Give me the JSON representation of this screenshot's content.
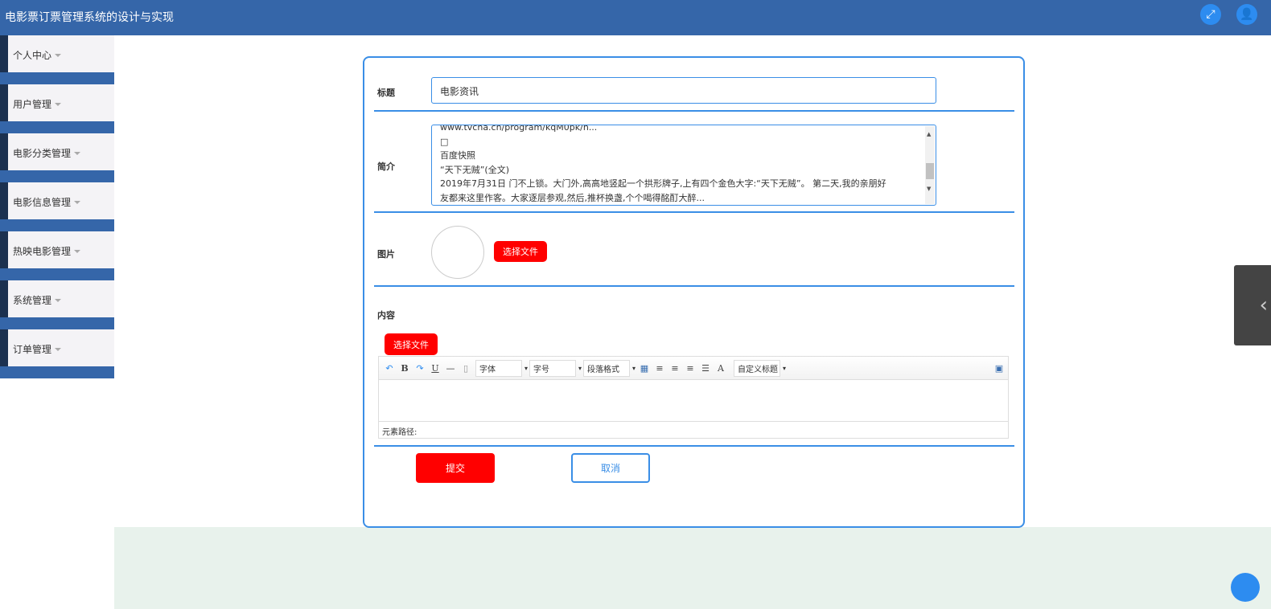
{
  "header": {
    "title": "电影票订票管理系统的设计与实现",
    "icons": [
      "fullscreen-icon",
      "user-icon"
    ]
  },
  "sidebar": {
    "items": [
      {
        "label": "个人中心"
      },
      {
        "label": "用户管理"
      },
      {
        "label": "电影分类管理"
      },
      {
        "label": "电影信息管理"
      },
      {
        "label": "热映电影管理"
      },
      {
        "label": "系统管理"
      },
      {
        "label": "订单管理"
      }
    ]
  },
  "form": {
    "title_label": "标题",
    "title_value": "电影资讯",
    "intro_label": "简介",
    "intro_lines": [
      "www.tvcha.cn/program/kqM0pk/h...",
      "□",
      "百度快照",
      "“天下无贼”(全文)",
      "2019年7月31日 门不上锁。大门外,高高地竖起一个拱形牌子,上有四个金色大字:“天下无贼”。 第二天,我的亲朋好",
      "友都来这里作客。大家逐层参观,然后,推杯换盏,个个喝得酩酊大醉..."
    ],
    "image_label": "图片",
    "choose_file": "选择文件",
    "content_label": "内容",
    "content_choose_file": "选择文件",
    "editor": {
      "font": "字体",
      "size": "字号",
      "paragraph": "段落格式",
      "custom_title": "自定义标题",
      "bold": "B",
      "underline": "U",
      "fontcolor": "A",
      "path_label": "元素路径:"
    },
    "submit": "提交",
    "cancel": "取消"
  },
  "colors": {
    "header": "#3566a9",
    "accent": "#3a8ee6",
    "danger": "#ff0000"
  }
}
